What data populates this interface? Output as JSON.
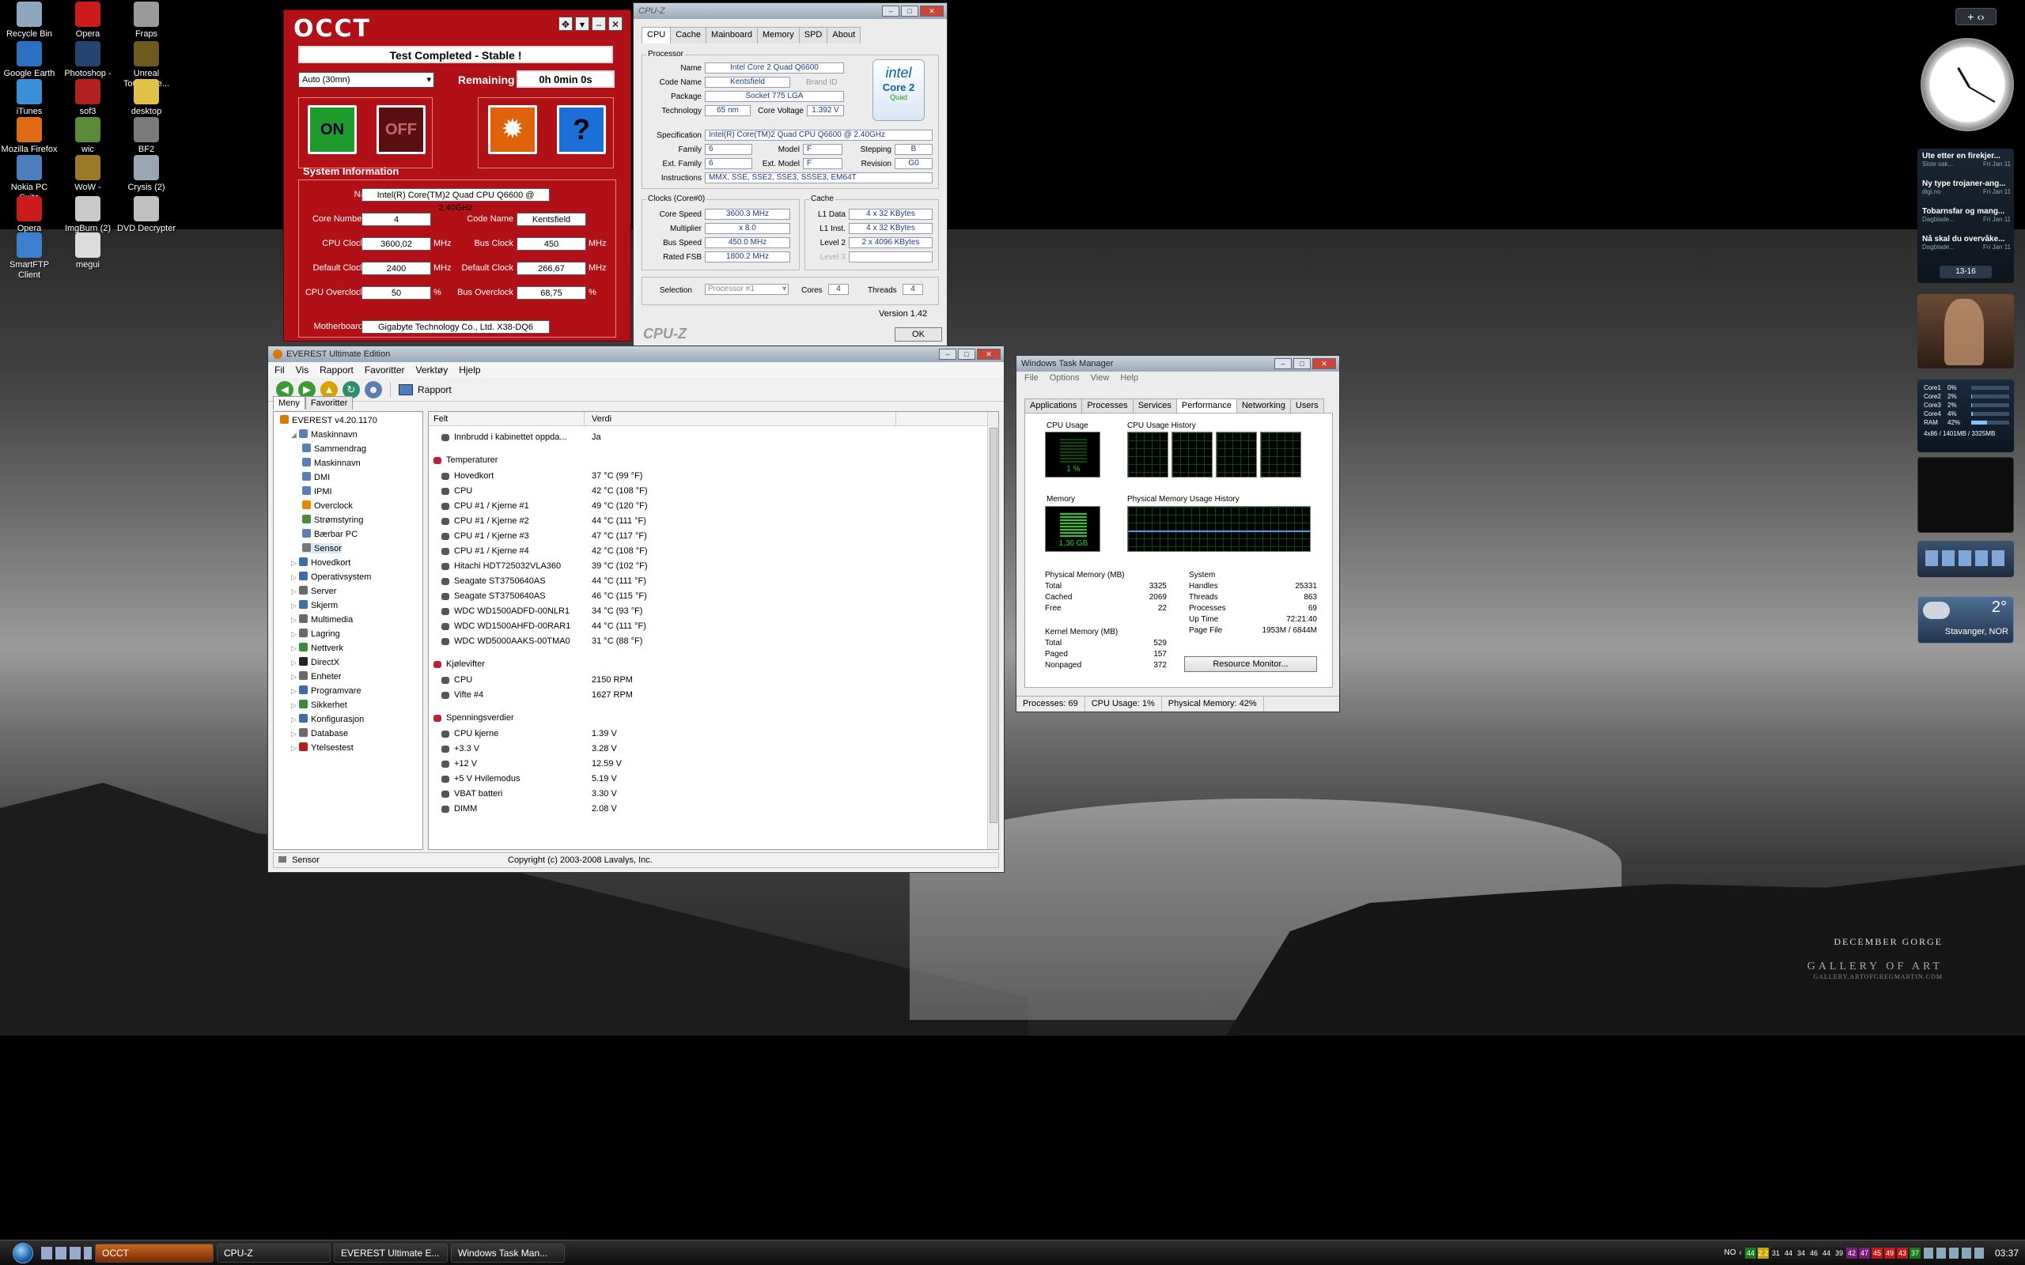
{
  "desktop_icons": [
    {
      "label": "Recycle Bin",
      "icon": "recycle-bin-icon",
      "color": "#8fa6bf"
    },
    {
      "label": "Opera",
      "icon": "opera-icon",
      "color": "#cc1b1b"
    },
    {
      "label": "Fraps",
      "icon": "fraps-icon",
      "color": "#9a9a9a"
    },
    {
      "label": "Google Earth",
      "icon": "globe-icon",
      "color": "#2d6fc0"
    },
    {
      "label": "Photoshop -",
      "icon": "photoshop-icon",
      "color": "#26446f"
    },
    {
      "label": "Unreal Tourname...",
      "icon": "unreal-icon",
      "color": "#6d5a1c"
    },
    {
      "label": "iTunes",
      "icon": "itunes-icon",
      "color": "#3a8fd6"
    },
    {
      "label": "sof3",
      "icon": "sof3-icon",
      "color": "#b11f1f"
    },
    {
      "label": "desktop",
      "icon": "folder-icon",
      "color": "#e0c14a"
    },
    {
      "label": "Mozilla Firefox",
      "icon": "firefox-icon",
      "color": "#e06a13"
    },
    {
      "label": "wic",
      "icon": "wic-icon",
      "color": "#5a8a3a"
    },
    {
      "label": "BF2",
      "icon": "bf2-icon",
      "color": "#7a7a7a"
    },
    {
      "label": "Nokia PC Suite",
      "icon": "nokia-icon",
      "color": "#4b7fbf"
    },
    {
      "label": "WoW -",
      "icon": "wow-icon",
      "color": "#9b7b2a"
    },
    {
      "label": "Crysis (2)",
      "icon": "crysis-icon",
      "color": "#9aa7b3"
    },
    {
      "label": "Opera",
      "icon": "opera-icon",
      "color": "#cc1b1b"
    },
    {
      "label": "ImgBurn (2)",
      "icon": "imgburn-icon",
      "color": "#c9c9c9"
    },
    {
      "label": "DVD Decrypter",
      "icon": "dvd-icon",
      "color": "#bfbfbf"
    },
    {
      "label": "SmartFTP Client",
      "icon": "smartftp-icon",
      "color": "#3f7fcf"
    },
    {
      "label": "megui",
      "icon": "megui-icon",
      "color": "#dcdcdc"
    }
  ],
  "wallpaper": {
    "title": "DECEMBER GORGE",
    "brand": "GALLERY OF ART",
    "sub": "GALLERY.ARTOFGREGMARTIN.COM"
  },
  "occt": {
    "logo": "OCCT",
    "banner": "Test Completed - Stable !",
    "mode": "Auto (30mn)",
    "remaining_label": "Remaining",
    "remaining_value": "0h 0min 0s",
    "on_label": "ON",
    "off_label": "OFF",
    "sysinfo_title": "System Information",
    "name_label": "Name",
    "name_value": "Intel(R) Core(TM)2 Quad CPU Q6600 @ 2.40GHz",
    "core_number_label": "Core Number",
    "core_number_value": "4",
    "code_name_label": "Code Name",
    "code_name_value": "Kentsfield",
    "cpu_clock_label": "CPU Clock",
    "cpu_clock_value": "3600,02",
    "bus_clock_label": "Bus Clock",
    "bus_clock_value": "450",
    "default_clock_label": "Default Clock",
    "default_clock_value": "2400",
    "default_clock2_label": "Default Clock",
    "default_clock2_value": "266,67",
    "cpu_overclock_label": "CPU Overclock",
    "cpu_overclock_value": "50",
    "bus_overclock_label": "Bus Overclock",
    "bus_overclock_value": "68,75",
    "motherboard_label": "Motherboard",
    "motherboard_value": "Gigabyte Technology Co., Ltd.  X38-DQ6",
    "unit_mhz": "MHz",
    "unit_pct": "%"
  },
  "cpuz": {
    "title": "CPU-Z",
    "tabs": [
      "CPU",
      "Cache",
      "Mainboard",
      "Memory",
      "SPD",
      "About"
    ],
    "processor_group": "Processor",
    "name_label": "Name",
    "name": "Intel Core 2 Quad Q6600",
    "codename_label": "Code Name",
    "codename": "Kentsfield",
    "brand_label": "Brand ID",
    "package_label": "Package",
    "package": "Socket 775 LGA",
    "tech_label": "Technology",
    "tech": "65 nm",
    "voltage_label": "Core Voltage",
    "voltage": "1.392 V",
    "spec_label": "Specification",
    "spec": "Intel(R) Core(TM)2 Quad CPU    Q6600  @ 2.40GHz",
    "family_label": "Family",
    "family": "6",
    "model_label": "Model",
    "model": "F",
    "stepping_label": "Stepping",
    "stepping": "B",
    "extfamily_label": "Ext. Family",
    "extfamily": "6",
    "extmodel_label": "Ext. Model",
    "extmodel": "F",
    "revision_label": "Revision",
    "revision": "G0",
    "instr_label": "Instructions",
    "instr": "MMX, SSE, SSE2, SSE3, SSSE3, EM64T",
    "clocks_group": "Clocks (Core#0)",
    "corespeed_label": "Core Speed",
    "corespeed": "3600.3 MHz",
    "mult_label": "Multiplier",
    "mult": "x 8.0",
    "bus_label": "Bus Speed",
    "bus": "450.0 MHz",
    "fsb_label": "Rated FSB",
    "fsb": "1800.2 MHz",
    "cache_group": "Cache",
    "l1d_label": "L1 Data",
    "l1d": "4 x 32 KBytes",
    "l1i_label": "L1 Inst.",
    "l1i": "4 x 32 KBytes",
    "l2_label": "Level 2",
    "l2": "2 x 4096 KBytes",
    "l3_label": "Level 3",
    "selection_label": "Selection",
    "selection": "Processor #1",
    "cores_label": "Cores",
    "cores": "4",
    "threads_label": "Threads",
    "threads": "4",
    "version": "Version 1.42",
    "footer_logo": "CPU-Z",
    "ok": "OK",
    "intel_logo": "intel",
    "intel_sub": "Core 2",
    "intel_sub2": "Quad"
  },
  "everest": {
    "title": "EVEREST Ultimate Edition",
    "menu": [
      "Fil",
      "Vis",
      "Rapport",
      "Favoritter",
      "Verktøy",
      "Hjelp"
    ],
    "toolbar_report": "Rapport",
    "tab_menu": "Meny",
    "tab_favorites": "Favoritter",
    "col_field": "Felt",
    "col_value": "Verdi",
    "tree": [
      {
        "label": "EVEREST v4.20.1170",
        "indent": 0,
        "color": "#d97a00"
      },
      {
        "label": "Maskinnavn",
        "indent": 1,
        "color": "#5b7fb5"
      },
      {
        "label": "Sammendrag",
        "indent": 2,
        "color": "#5b7fb5"
      },
      {
        "label": "Maskinnavn",
        "indent": 2,
        "color": "#5b7fb5"
      },
      {
        "label": "DMI",
        "indent": 2,
        "color": "#5b7fb5"
      },
      {
        "label": "IPMI",
        "indent": 2,
        "color": "#5b7fb5"
      },
      {
        "label": "Overclock",
        "indent": 2,
        "color": "#e08a00"
      },
      {
        "label": "Strømstyring",
        "indent": 2,
        "color": "#4a8a3a"
      },
      {
        "label": "Bærbar PC",
        "indent": 2,
        "color": "#5b7fb5"
      },
      {
        "label": "Sensor",
        "indent": 2,
        "color": "#777777"
      },
      {
        "label": "Hovedkort",
        "indent": 1,
        "color": "#3a6ea5"
      },
      {
        "label": "Operativsystem",
        "indent": 1,
        "color": "#3a6ea5"
      },
      {
        "label": "Server",
        "indent": 1,
        "color": "#6a6a6a"
      },
      {
        "label": "Skjerm",
        "indent": 1,
        "color": "#3a6ea5"
      },
      {
        "label": "Multimedia",
        "indent": 1,
        "color": "#6a6a6a"
      },
      {
        "label": "Lagring",
        "indent": 1,
        "color": "#6a6a6a"
      },
      {
        "label": "Nettverk",
        "indent": 1,
        "color": "#3a8a3a"
      },
      {
        "label": "DirectX",
        "indent": 1,
        "color": "#222222"
      },
      {
        "label": "Enheter",
        "indent": 1,
        "color": "#6a6a6a"
      },
      {
        "label": "Programvare",
        "indent": 1,
        "color": "#3a6ea5"
      },
      {
        "label": "Sikkerhet",
        "indent": 1,
        "color": "#3a8a3a"
      },
      {
        "label": "Konfigurasjon",
        "indent": 1,
        "color": "#3a6ea5"
      },
      {
        "label": "Database",
        "indent": 1,
        "color": "#6a6a6a"
      },
      {
        "label": "Ytelsestest",
        "indent": 1,
        "color": "#b02020"
      }
    ],
    "rows": [
      {
        "field": "Innbrudd i kabinettet oppda...",
        "value": "Ja",
        "type": "item"
      },
      {
        "field": "",
        "value": "",
        "type": "gap"
      },
      {
        "field": "Temperaturer",
        "value": "",
        "type": "header"
      },
      {
        "field": "Hovedkort",
        "value": "37 °C  (99 °F)",
        "type": "item"
      },
      {
        "field": "CPU",
        "value": "42 °C  (108 °F)",
        "type": "item"
      },
      {
        "field": "CPU #1 / Kjerne #1",
        "value": "49 °C  (120 °F)",
        "type": "item"
      },
      {
        "field": "CPU #1 / Kjerne #2",
        "value": "44 °C  (111 °F)",
        "type": "item"
      },
      {
        "field": "CPU #1 / Kjerne #3",
        "value": "47 °C  (117 °F)",
        "type": "item"
      },
      {
        "field": "CPU #1 / Kjerne #4",
        "value": "42 °C  (108 °F)",
        "type": "item"
      },
      {
        "field": "Hitachi HDT725032VLA360",
        "value": "39 °C  (102 °F)",
        "type": "item"
      },
      {
        "field": "Seagate ST3750640AS",
        "value": "44 °C  (111 °F)",
        "type": "item"
      },
      {
        "field": "Seagate ST3750640AS",
        "value": "46 °C  (115 °F)",
        "type": "item"
      },
      {
        "field": "WDC WD1500ADFD-00NLR1",
        "value": "34 °C  (93 °F)",
        "type": "item"
      },
      {
        "field": "WDC WD1500AHFD-00RAR1",
        "value": "44 °C  (111 °F)",
        "type": "item"
      },
      {
        "field": "WDC WD5000AAKS-00TMA0",
        "value": "31 °C  (88 °F)",
        "type": "item"
      },
      {
        "field": "",
        "value": "",
        "type": "gap"
      },
      {
        "field": "Kjølevifter",
        "value": "",
        "type": "header"
      },
      {
        "field": "CPU",
        "value": "2150 RPM",
        "type": "item"
      },
      {
        "field": "Vifte #4",
        "value": "1627 RPM",
        "type": "item"
      },
      {
        "field": "",
        "value": "",
        "type": "gap"
      },
      {
        "field": "Spenningsverdier",
        "value": "",
        "type": "header"
      },
      {
        "field": "CPU kjerne",
        "value": "1.39 V",
        "type": "item"
      },
      {
        "field": "+3.3 V",
        "value": "3.28 V",
        "type": "item"
      },
      {
        "field": "+12 V",
        "value": "12.59 V",
        "type": "item"
      },
      {
        "field": "+5 V Hvilemodus",
        "value": "5.19 V",
        "type": "item"
      },
      {
        "field": "VBAT batteri",
        "value": "3.30 V",
        "type": "item"
      },
      {
        "field": "DIMM",
        "value": "2.08 V",
        "type": "item"
      }
    ],
    "status_left": "Sensor",
    "status_copy": "Copyright (c) 2003-2008 Lavalys, Inc."
  },
  "taskmgr": {
    "title": "Windows Task Manager",
    "menu": [
      "File",
      "Options",
      "View",
      "Help"
    ],
    "tabs": [
      "Applications",
      "Processes",
      "Services",
      "Performance",
      "Networking",
      "Users"
    ],
    "cpu_usage_label": "CPU Usage",
    "cpu_usage_value": "1 %",
    "cpu_history_label": "CPU Usage History",
    "memory_label": "Memory",
    "memory_value": "1,36 GB",
    "phys_history_label": "Physical Memory Usage History",
    "phys_title": "Physical Memory (MB)",
    "phys": [
      [
        "Total",
        "3325"
      ],
      [
        "Cached",
        "2069"
      ],
      [
        "Free",
        "22"
      ]
    ],
    "system_title": "System",
    "system": [
      [
        "Handles",
        "25331"
      ],
      [
        "Threads",
        "863"
      ],
      [
        "Processes",
        "69"
      ],
      [
        "Up Time",
        "72:21:40"
      ],
      [
        "Page File",
        "1953M / 6844M"
      ]
    ],
    "kernel_title": "Kernel Memory (MB)",
    "kernel": [
      [
        "Total",
        "529"
      ],
      [
        "Paged",
        "157"
      ],
      [
        "Nonpaged",
        "372"
      ]
    ],
    "resource_btn": "Resource Monitor...",
    "status": [
      "Processes: 69",
      "CPU Usage: 1%",
      "Physical Memory: 42%"
    ]
  },
  "gadgets": {
    "feeds": [
      {
        "title": "Ute etter en firekjer...",
        "src": "Siste sak...",
        "date": "Fri Jan 11"
      },
      {
        "title": "Ny type trojaner-ang...",
        "src": "digi.no",
        "date": "Fri Jan 11"
      },
      {
        "title": "Tobarnsfar og mang...",
        "src": "Dagblade...",
        "date": "Fri Jan 11"
      },
      {
        "title": "Nå skal du overvåke...",
        "src": "Dagblade...",
        "date": "Fri Jan 11"
      }
    ],
    "feed_pager": "13-16",
    "meter": [
      [
        "Core1",
        "0%"
      ],
      [
        "Core2",
        "2%"
      ],
      [
        "Core3",
        "2%"
      ],
      [
        "Core4",
        "4%"
      ],
      [
        "RAM",
        "42%"
      ]
    ],
    "meter_mem": "4x86 / 1401MB / 3325MB",
    "weather_temp": "2°",
    "weather_city": "Stavanger, NOR"
  },
  "taskbar": {
    "buttons": [
      "OCCT",
      "CPU-Z",
      "EVEREST Ultimate E...",
      "Windows Task Man..."
    ],
    "lang": "NO",
    "temps": [
      "44",
      "2.2",
      "31",
      "44",
      "34",
      "46",
      "44",
      "39",
      "42",
      "47",
      "45",
      "49",
      "43",
      "37"
    ],
    "clock": "03:37"
  },
  "colors": {
    "occt_red": "#b01016",
    "graph_green": "#1bd41b",
    "everest_link": "#1b4fa0"
  }
}
